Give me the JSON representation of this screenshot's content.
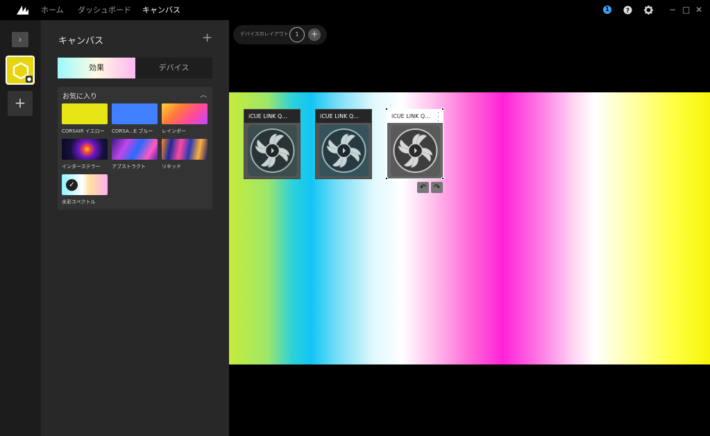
{
  "titlebar": {
    "logo": "corsair-sails-logo",
    "nav": [
      "ホーム",
      "ダッシュボード",
      "キャンバス"
    ],
    "active_nav": "キャンバス",
    "notification_count": "1",
    "icons": [
      "notification-icon",
      "help-icon",
      "settings-icon"
    ],
    "window_controls": [
      "−",
      "□",
      "✕"
    ]
  },
  "rail": {
    "expand_icon": "chevron-right-icon",
    "canvas_color": "#e6d40d",
    "add_symbol": "+"
  },
  "panel": {
    "title": "キャンバス",
    "add_symbol": "+",
    "tabs": [
      "効果",
      "デバイス"
    ],
    "favorites": {
      "title": "お気に入り",
      "effects": [
        {
          "label": "CORSAIR イエロー",
          "color": "#e6e617"
        },
        {
          "label": "CORSA…E ブルー",
          "color": "#4080ff"
        },
        {
          "label": "レインボー",
          "color": "rainbow"
        },
        {
          "label": "インターステラー",
          "color": "#1a1040"
        },
        {
          "label": "アブストラクト",
          "color": "#6a2fc0"
        },
        {
          "label": "リキッド",
          "color": "#2a3ab0"
        },
        {
          "label": "水彩スペクトル",
          "color": "spectrum",
          "selected": true
        }
      ]
    }
  },
  "layout": {
    "label": "デバイスのレイアウト",
    "count": "1",
    "add_symbol": "+"
  },
  "devices": [
    {
      "name": "iCUE LINK Q…",
      "selected": false
    },
    {
      "name": "iCUE LINK Q…",
      "selected": false
    },
    {
      "name": "iCUE LINK Q…",
      "selected": true
    }
  ],
  "rotate_controls": [
    "rotate-left-icon",
    "rotate-right-icon"
  ]
}
